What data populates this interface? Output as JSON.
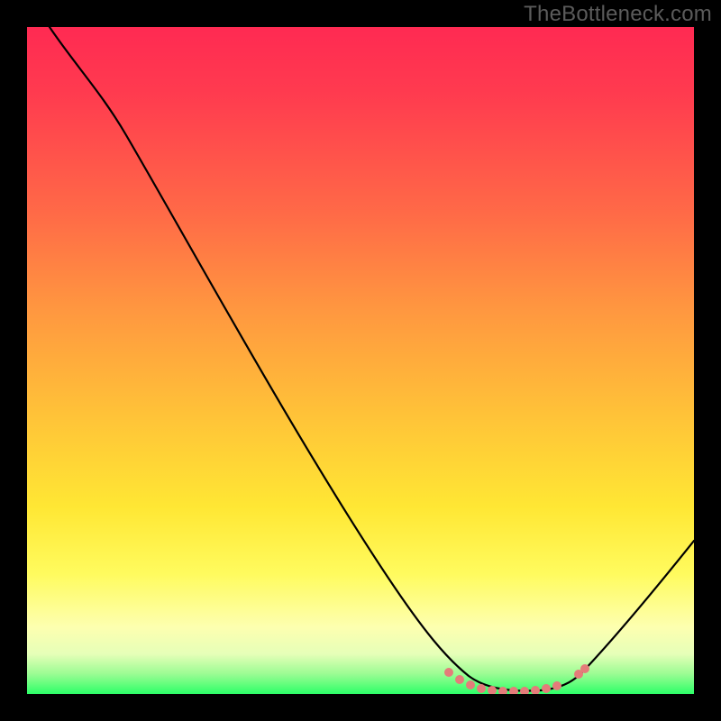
{
  "watermark": "TheBottleneck.com",
  "chart_data": {
    "type": "line",
    "title": "",
    "xlabel": "",
    "ylabel": "",
    "x": [
      0,
      5,
      10,
      15,
      20,
      25,
      30,
      35,
      40,
      45,
      50,
      55,
      60,
      62,
      64,
      66,
      68,
      70,
      72,
      74,
      76,
      78,
      80,
      84,
      88,
      92,
      96,
      100
    ],
    "values": [
      100,
      98,
      95,
      91,
      86,
      80,
      73,
      65,
      57,
      49,
      40,
      31,
      22,
      18,
      14,
      10,
      6.5,
      3.8,
      2.0,
      0.9,
      0.3,
      0.2,
      0.4,
      1.5,
      4.0,
      8.0,
      13.0,
      19.0
    ],
    "xlim": [
      0,
      100
    ],
    "ylim": [
      0,
      100
    ],
    "highlight_points_x": [
      62,
      64,
      66,
      68,
      70,
      72,
      74,
      76,
      78,
      80,
      83,
      84
    ],
    "highlight_points_y": [
      3.5,
      2.2,
      1.2,
      0.7,
      0.5,
      0.4,
      0.4,
      0.5,
      0.8,
      1.3,
      2.6,
      3.2
    ],
    "highlight_color": "#e47c7a",
    "curve_color": "#000000",
    "gradient_stops": [
      {
        "pos": 0.0,
        "color": "#ff2a52"
      },
      {
        "pos": 0.28,
        "color": "#ff6a47"
      },
      {
        "pos": 0.58,
        "color": "#ffc238"
      },
      {
        "pos": 0.82,
        "color": "#fffb5e"
      },
      {
        "pos": 0.97,
        "color": "#9bfc93"
      },
      {
        "pos": 1.0,
        "color": "#2dff68"
      }
    ]
  }
}
